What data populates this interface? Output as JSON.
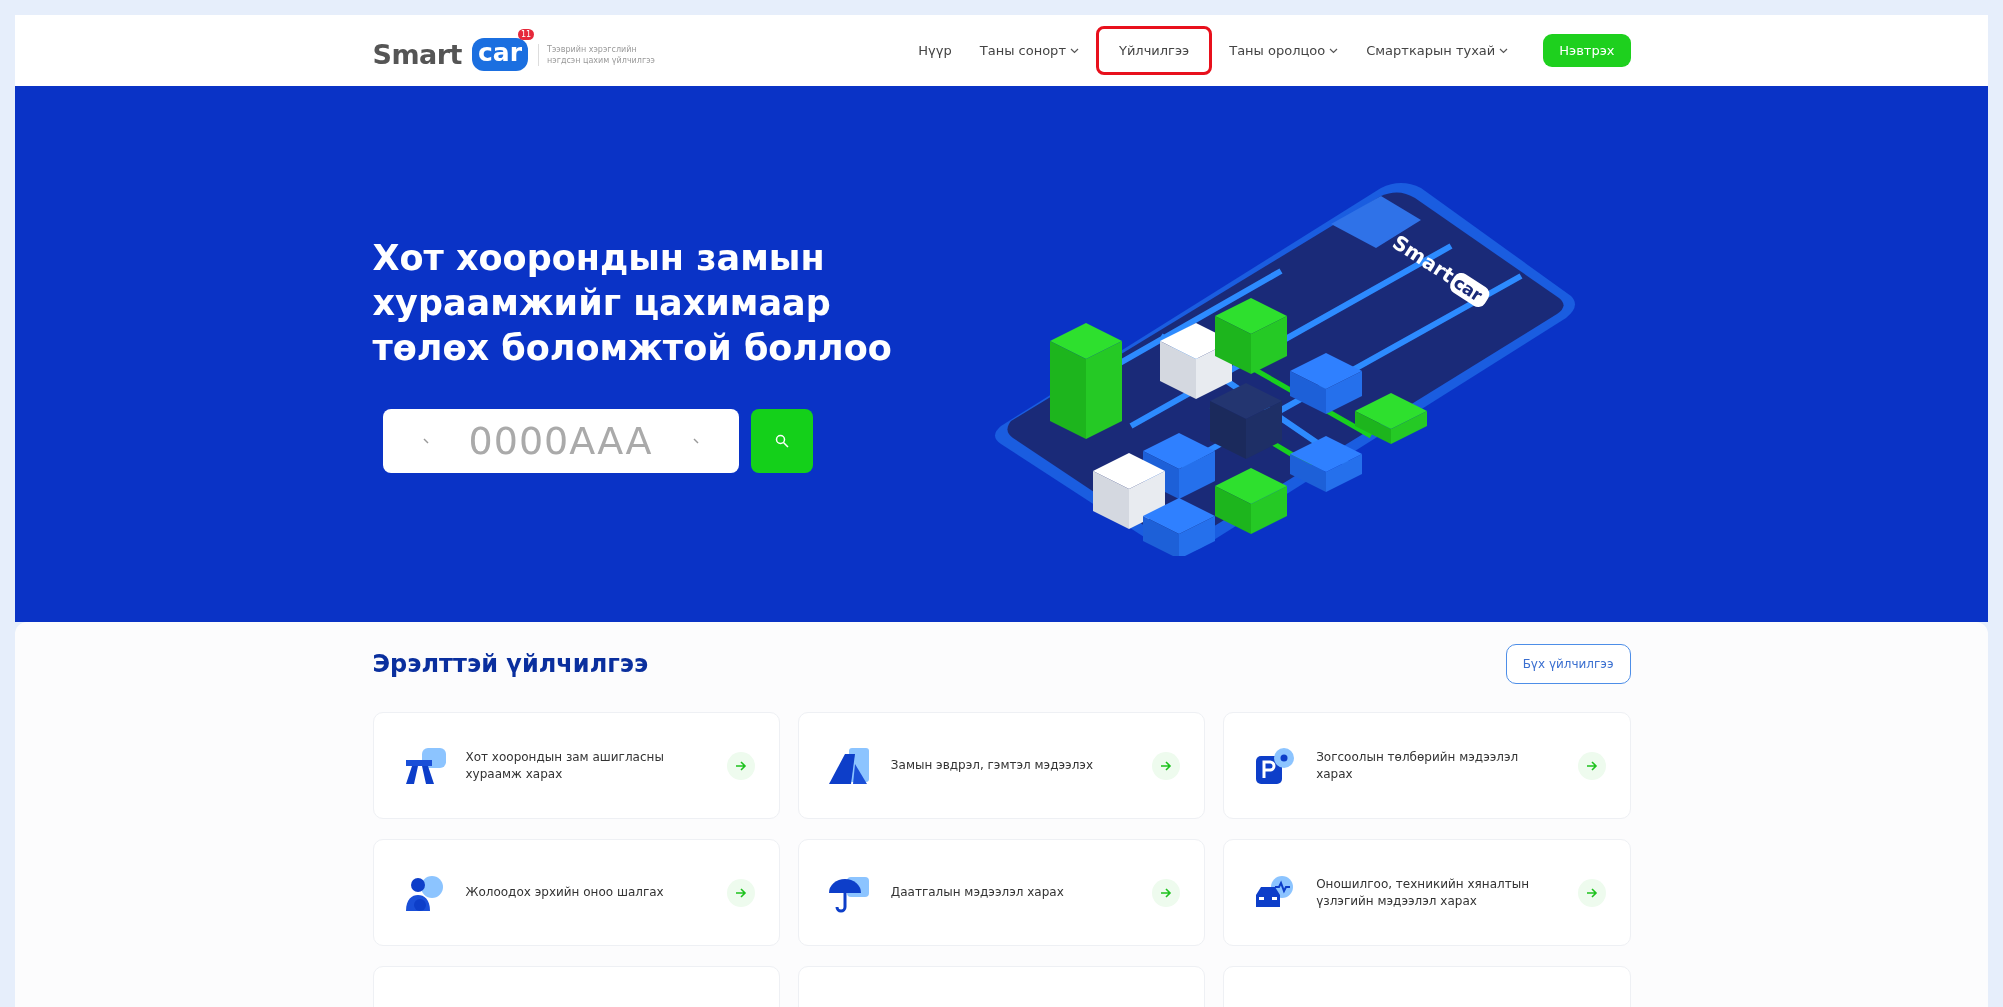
{
  "header": {
    "logo": {
      "smart": "Smart",
      "car": "car",
      "badge": "11",
      "tagline_lines": [
        "Тээврийн хэрэгслийн",
        "нэгдсэн цахим үйлчилгээ"
      ]
    },
    "nav": [
      {
        "label": "Нүүр",
        "dropdown": false,
        "selected": false
      },
      {
        "label": "Таны сонорт",
        "dropdown": true,
        "selected": false
      },
      {
        "label": "Үйлчилгээ",
        "dropdown": false,
        "selected": true
      },
      {
        "label": "Таны оролцоо",
        "dropdown": true,
        "selected": false
      },
      {
        "label": "Смарткарын тухай",
        "dropdown": true,
        "selected": false
      }
    ],
    "login_button": "Нэвтрэх"
  },
  "hero": {
    "title_lines": [
      "Хот хоорондын замын",
      "хураамжийг цахимаар",
      "төлөх боломжтой боллоо"
    ],
    "plate_field": {
      "placeholder": "0000AAA"
    },
    "phone_logo": {
      "smart": "Smart",
      "car": "car"
    }
  },
  "services": {
    "heading": "Эрэлттэй үйлчилгээ",
    "all_button": "Бүх үйлчилгээ",
    "cards": [
      {
        "text": "Хот хоорондын зам ашигласны хураамж харах"
      },
      {
        "text": "Замын эвдрэл, гэмтэл мэдээлэх"
      },
      {
        "text": "Зогсоолын төлбөрийн мэдээлэл харах"
      },
      {
        "text": "Жолоодох эрхийн оноо шалгах"
      },
      {
        "text": "Даатгалын мэдээлэл харах"
      },
      {
        "text": "Оношилгоо, техникийн хяналтын үзлэгийн мэдээлэл харах"
      }
    ]
  }
}
